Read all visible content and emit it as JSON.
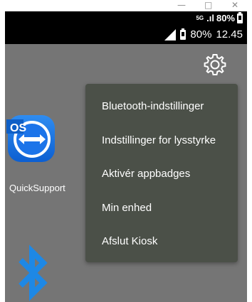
{
  "window": {
    "minimize_glyph": "—",
    "maximize_glyph": "□",
    "close_glyph": "✕"
  },
  "host_status": {
    "network_tag": "5G",
    "signal_text": ".ıl",
    "battery": "80%"
  },
  "device_status": {
    "battery": "80%",
    "time": "12.45"
  },
  "apps": [
    {
      "label": "QuickSupport",
      "icon": "teamviewer-quicksupport-icon"
    },
    {
      "label": "",
      "icon": "bluetooth-icon"
    }
  ],
  "menu": {
    "items": [
      {
        "label": "Bluetooth-indstillinger"
      },
      {
        "label": "Indstillinger for lysstyrke"
      },
      {
        "label": "Aktivér appbadges"
      },
      {
        "label": "Min enhed"
      },
      {
        "label": "Afslut Kiosk"
      }
    ]
  },
  "colors": {
    "device_bg": "#757575",
    "menu_bg": "#4b5048",
    "accent_blue": "#1e88e5"
  }
}
